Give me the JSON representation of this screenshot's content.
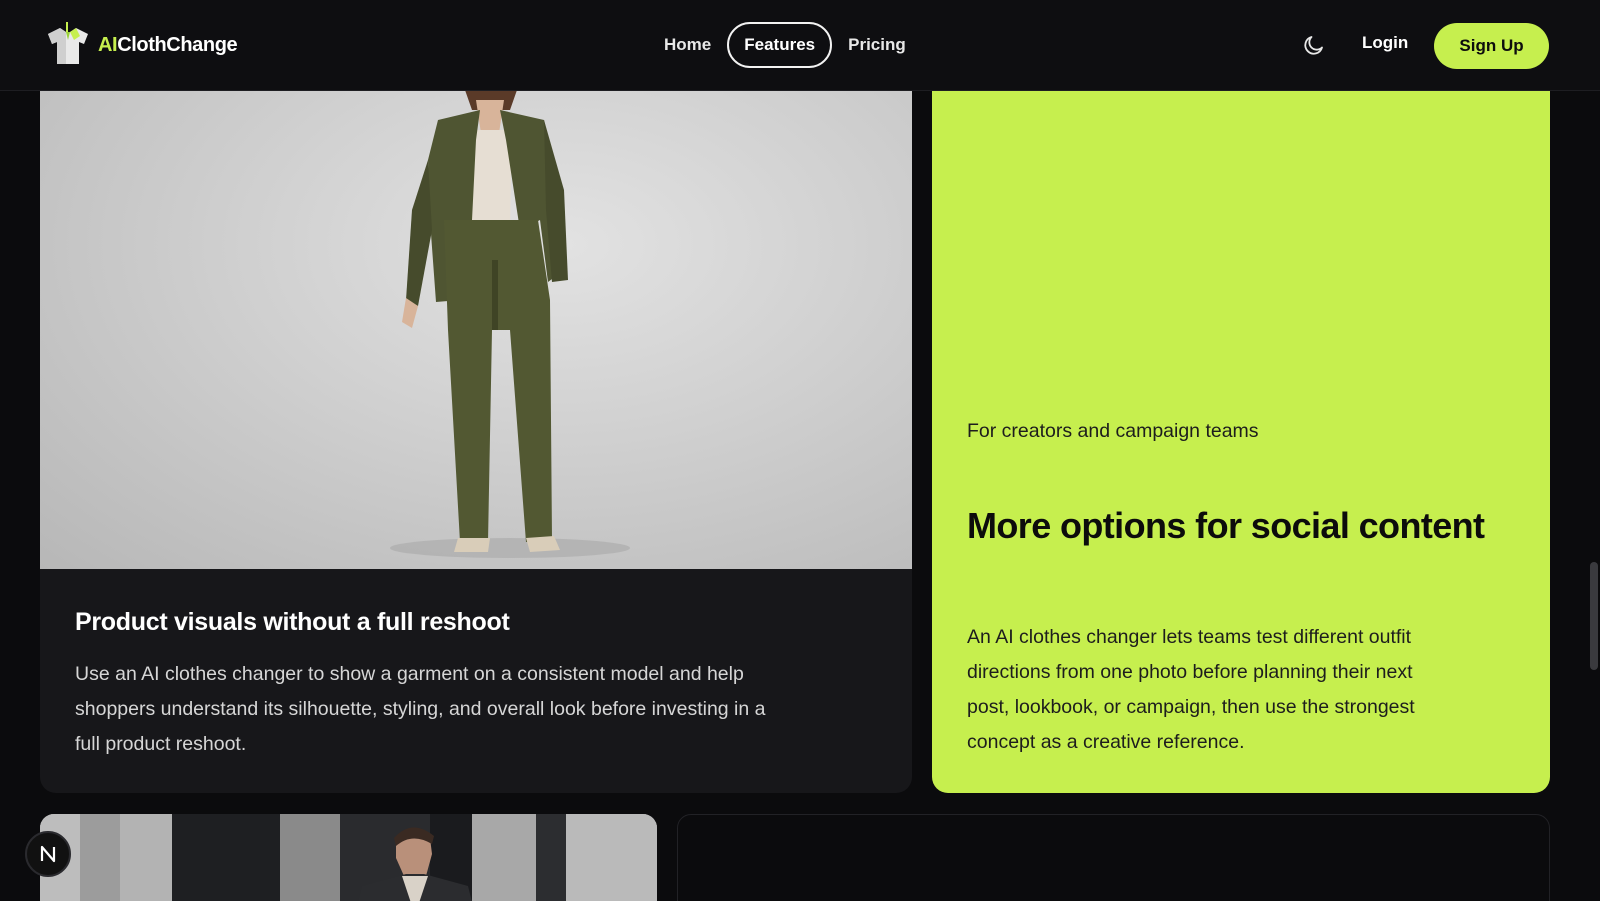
{
  "header": {
    "logo": {
      "prefix": "AI",
      "name": "ClothChange",
      "icon": "shirt-logo-icon"
    },
    "nav": [
      {
        "label": "Home",
        "active": false
      },
      {
        "label": "Features",
        "active": true
      },
      {
        "label": "Pricing",
        "active": false
      }
    ],
    "theme_icon": "moon-icon",
    "login_label": "Login",
    "signup_label": "Sign Up"
  },
  "feature_left": {
    "image": "woman-in-olive-suit-photo",
    "title": "Product visuals without a full reshoot",
    "description": "Use an AI clothes changer to show a garment on a consistent model and help shoppers understand its silhouette, styling, and overall look before investing in a full product reshoot."
  },
  "feature_right": {
    "eyebrow": "For creators and campaign teams",
    "title": "More options for social content",
    "description": "An AI clothes changer lets teams test different outfit directions from one photo before planning their next post, lookbook, or campaign, then use the strongest concept as a creative reference."
  },
  "bottom_left": {
    "image": "man-in-dark-jacket-photo"
  },
  "badge": {
    "icon": "n-logo-icon"
  },
  "colors": {
    "accent": "#c6ef4e",
    "background": "#0b0b0d",
    "card_dark": "#17171a"
  }
}
